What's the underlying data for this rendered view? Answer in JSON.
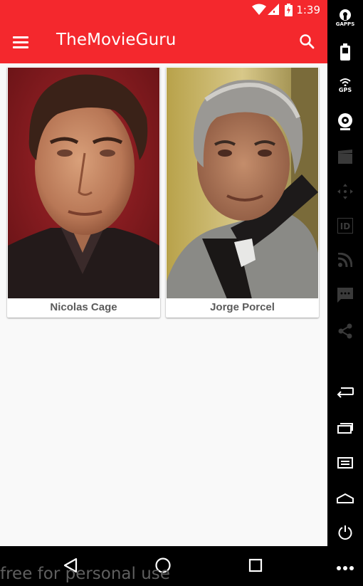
{
  "status_bar": {
    "time": "1:39"
  },
  "app_bar": {
    "title": "TheMovieGuru"
  },
  "people": [
    {
      "name": "Nicolas Cage"
    },
    {
      "name": "Jorge Porcel"
    }
  ],
  "side_toolbar": {
    "gapps_label": "GAPPS",
    "gps_label": "GPS"
  },
  "watermark": "free for personal use",
  "colors": {
    "primary": "#f4282d",
    "background": "#f9f9f9",
    "name_text": "#5b5b5b"
  }
}
